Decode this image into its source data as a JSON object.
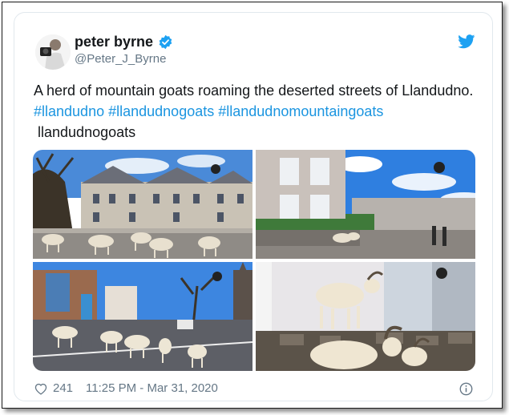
{
  "tweet": {
    "display_name": "peter byrne",
    "handle": "@Peter_J_Byrne",
    "text_plain": "A herd of mountain goats roaming the deserted streets of Llandudno. ",
    "hashtags": [
      "#llandudno",
      "#llandudnogoats",
      "#llandudnomountaingoats"
    ],
    "trailing_text": "llandudnogoats",
    "likes": "241",
    "timestamp": "11:25 PM - Mar 31, 2020"
  },
  "colors": {
    "link": "#1b95e0",
    "text": "#14171a",
    "muted": "#657786",
    "twitter_blue": "#1da1f2"
  },
  "icons": [
    "verified-badge-icon",
    "twitter-bird-icon",
    "heart-icon",
    "info-icon"
  ]
}
